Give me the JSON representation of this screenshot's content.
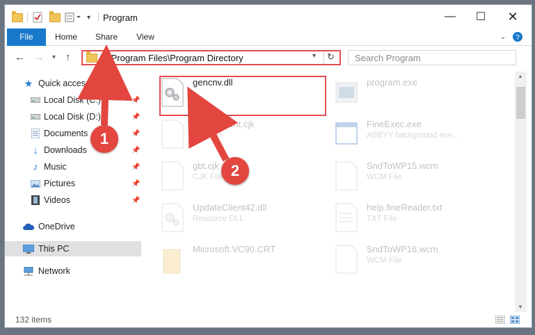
{
  "window": {
    "title": "Program"
  },
  "ribbon": {
    "tabs": [
      "File",
      "Home",
      "Share",
      "View"
    ]
  },
  "address": {
    "path": "C:\\Program Files\\Program Directory"
  },
  "search": {
    "placeholder": "Search Program"
  },
  "sidebar": {
    "items": [
      {
        "label": "Quick access",
        "icon": "star-icon"
      },
      {
        "label": "Local Disk (C:)",
        "icon": "drive-icon",
        "pinned": true
      },
      {
        "label": "Local Disk (D:)",
        "icon": "drive-icon",
        "pinned": true
      },
      {
        "label": "Documents",
        "icon": "documents-icon",
        "pinned": true
      },
      {
        "label": "Downloads",
        "icon": "download-icon",
        "pinned": true
      },
      {
        "label": "Music",
        "icon": "music-icon",
        "pinned": true
      },
      {
        "label": "Pictures",
        "icon": "pictures-icon",
        "pinned": true
      },
      {
        "label": "Videos",
        "icon": "videos-icon",
        "pinned": true
      },
      {
        "label": "OneDrive",
        "icon": "cloud-icon"
      },
      {
        "label": "This PC",
        "icon": "pc-icon",
        "selected": true
      },
      {
        "label": "Network",
        "icon": "network-icon"
      }
    ]
  },
  "files": {
    "left": [
      {
        "name": "gencnv.dll",
        "type": ""
      },
      {
        "name": "FineExment.cjk",
        "type": "CJK File"
      },
      {
        "name": "gbt.cjk",
        "type": "CJK File"
      },
      {
        "name": "UpdateClient42.dll",
        "type": "Resource DLL"
      },
      {
        "name": "Microsoft.VC90.CRT",
        "type": ""
      }
    ],
    "right": [
      {
        "name": "program.exe",
        "type": ""
      },
      {
        "name": "FineExec.exe",
        "type": "ABBYY background exe..."
      },
      {
        "name": "SndToWP15.wcm",
        "type": "WCM File"
      },
      {
        "name": "help.fineReader.txt",
        "type": "TXT File"
      },
      {
        "name": "SndToWP16.wcm",
        "type": "WCM File"
      }
    ]
  },
  "status": {
    "count": "132 items"
  },
  "callouts": [
    "1",
    "2"
  ],
  "colors": {
    "accent": "#1979ca",
    "annotation": "#e44c50"
  }
}
